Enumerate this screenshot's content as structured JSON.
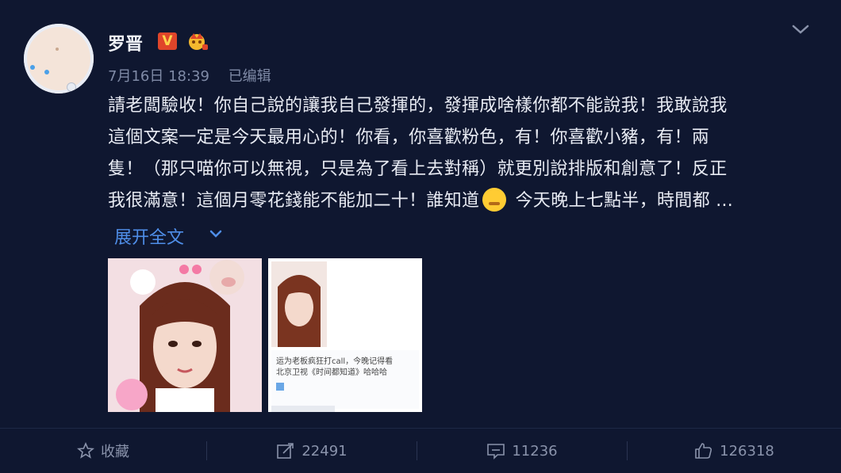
{
  "post": {
    "username": "罗晋",
    "v_badge": "V",
    "date": "7月16日 18:39",
    "edited": "已编辑",
    "text_lines": [
      "請老闆驗收！你自己說的讓我自己發揮的，發揮成啥樣你都不能說我！我敢說我",
      "這個文案一定是今天最用心的！你看，你喜歡粉色，有！你喜歡小豬，有！兩",
      "隻！（那只喵你可以無視，只是為了看上去對稱）就更別說排版和創意了！反正",
      "我很滿意！這個月零花錢能不能加二十！誰知道"
    ],
    "text_tail": " 今天晚上七點半，時間都 ...",
    "expand_label": "展开全文",
    "image2_caption_1": "运为老板疯狂打call，今晚记得看",
    "image2_caption_2": "北京卫视《时间都知道》哈哈哈"
  },
  "actions": {
    "favorite": "收藏",
    "repost": "22491",
    "comment": "11236",
    "like": "126318"
  },
  "colors": {
    "background": "#0f1730",
    "link": "#4f8ee8",
    "v_badge": "#e0452a"
  }
}
